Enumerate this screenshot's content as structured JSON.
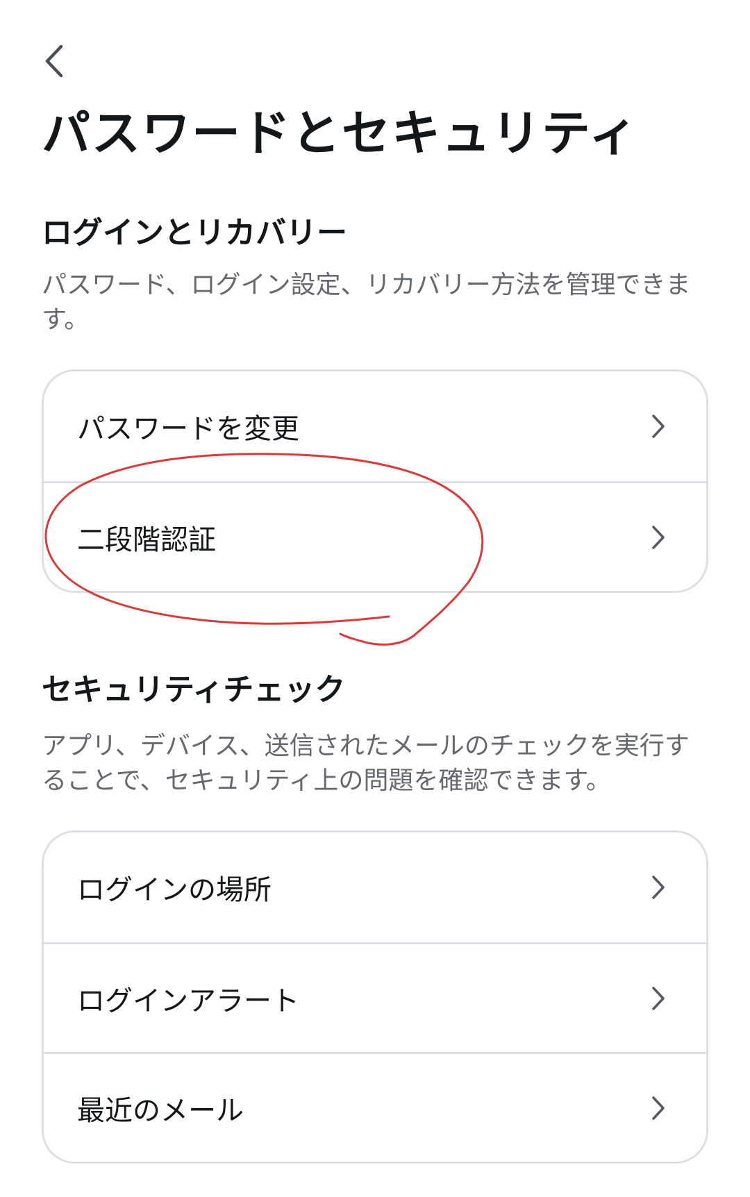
{
  "header": {
    "back_icon": "chevron-left-icon",
    "title": "パスワードとセキュリティ"
  },
  "login_recovery": {
    "heading": "ログインとリカバリー",
    "description": "パスワード、ログイン設定、リカバリー方法を管理できます。",
    "items": [
      {
        "label": "パスワードを変更",
        "icon": "chevron-right-icon"
      },
      {
        "label": "二段階認証",
        "icon": "chevron-right-icon"
      }
    ]
  },
  "security_check": {
    "heading": "セキュリティチェック",
    "description": "アプリ、デバイス、送信されたメールのチェックを実行することで、セキュリティ上の問題を確認できます。",
    "items": [
      {
        "label": "ログインの場所",
        "icon": "chevron-right-icon"
      },
      {
        "label": "ログインアラート",
        "icon": "chevron-right-icon"
      },
      {
        "label": "最近のメール",
        "icon": "chevron-right-icon"
      }
    ]
  },
  "colors": {
    "text_primary": "#14171a",
    "text_secondary": "#65686d",
    "divider": "#dcdfe3",
    "annotation": "#d93a3a"
  }
}
